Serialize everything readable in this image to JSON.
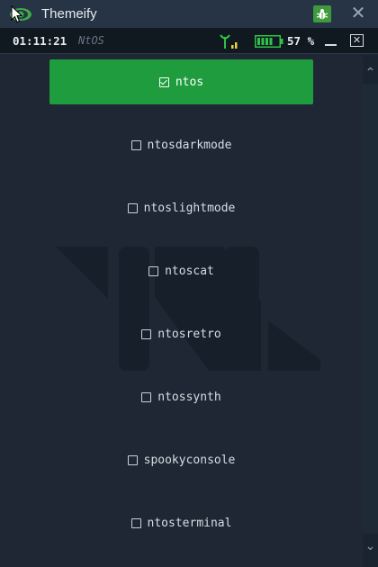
{
  "window": {
    "title": "Themeify",
    "logo_icon": "eye-logo-icon",
    "bug_icon": "bug-icon",
    "close_icon": "close-icon",
    "close_glyph": "✕"
  },
  "statusbar": {
    "time": "01:11:21",
    "os_name": "NtOS",
    "signal_icon": "signal-antenna-icon",
    "battery_icon": "battery-icon",
    "battery_level_percent": 57,
    "battery_text": "57 %",
    "minimize_icon": "minimize-icon",
    "close_glyph": "✕"
  },
  "themes": [
    {
      "label": "ntos",
      "selected": true
    },
    {
      "label": "ntosdarkmode",
      "selected": false
    },
    {
      "label": "ntoslightmode",
      "selected": false
    },
    {
      "label": "ntoscat",
      "selected": false
    },
    {
      "label": "ntosretro",
      "selected": false
    },
    {
      "label": "ntossynth",
      "selected": false
    },
    {
      "label": "spookyconsole",
      "selected": false
    },
    {
      "label": "ntosterminal",
      "selected": false
    }
  ],
  "scroll": {
    "up_glyph": "⌃",
    "down_glyph": "⌄"
  },
  "colors": {
    "accent": "#1f9c3d",
    "background": "#1e2733",
    "titlebar": "#263445",
    "statusbar": "#101820"
  }
}
